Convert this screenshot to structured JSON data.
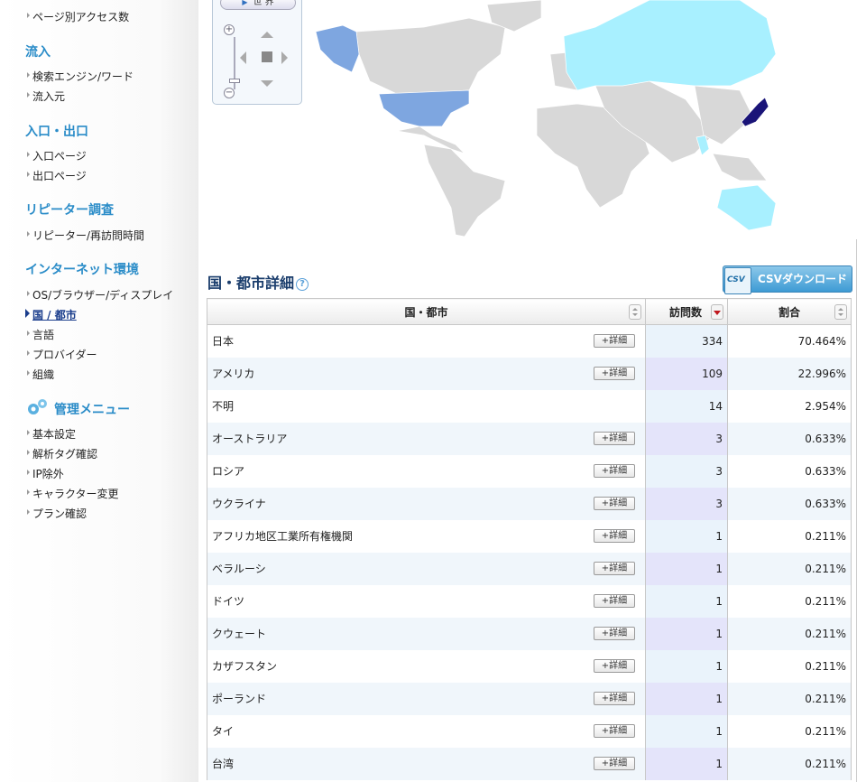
{
  "sidebar": {
    "top_item": "ページ別アクセス数",
    "sections": [
      {
        "title": "流入",
        "items": [
          "検索エンジン/ワード",
          "流入元"
        ]
      },
      {
        "title": "入口・出口",
        "items": [
          "入口ページ",
          "出口ページ"
        ]
      },
      {
        "title": "リピーター調査",
        "items": [
          "リピーター/再訪問時間"
        ]
      },
      {
        "title": "インターネット環境",
        "items": [
          "OS/ブラウザー/ディスプレイ",
          "国 / 都市",
          "言語",
          "プロバイダー",
          "組織"
        ]
      },
      {
        "title": "管理メニュー",
        "items": [
          "基本設定",
          "解析タグ確認",
          "IP除外",
          "キャラクター変更",
          "プラン確認"
        ]
      }
    ],
    "active_item": "国 / 都市"
  },
  "map": {
    "world_button": "世 界",
    "colors": {
      "high": "#1a1478",
      "mid": "#7ea6e0",
      "low": "#a8f0ff",
      "none": "#d8d8d8"
    }
  },
  "main": {
    "title": "国・都市詳細",
    "help": "?",
    "csv_button": "CSVダウンロード",
    "csv_icon": "CSV",
    "table": {
      "headers": [
        "国・都市",
        "訪問数",
        "割合"
      ],
      "detail_label": "+詳細",
      "rows": [
        {
          "name": "日本",
          "visits": "334",
          "share": "70.464%",
          "detail": true
        },
        {
          "name": "アメリカ",
          "visits": "109",
          "share": "22.996%",
          "detail": true
        },
        {
          "name": "不明",
          "visits": "14",
          "share": "2.954%",
          "detail": false
        },
        {
          "name": "オーストラリア",
          "visits": "3",
          "share": "0.633%",
          "detail": true
        },
        {
          "name": "ロシア",
          "visits": "3",
          "share": "0.633%",
          "detail": true
        },
        {
          "name": "ウクライナ",
          "visits": "3",
          "share": "0.633%",
          "detail": true
        },
        {
          "name": "アフリカ地区工業所有権機関",
          "visits": "1",
          "share": "0.211%",
          "detail": true
        },
        {
          "name": "ベラルーシ",
          "visits": "1",
          "share": "0.211%",
          "detail": true
        },
        {
          "name": "ドイツ",
          "visits": "1",
          "share": "0.211%",
          "detail": true
        },
        {
          "name": "クウェート",
          "visits": "1",
          "share": "0.211%",
          "detail": true
        },
        {
          "name": "カザフスタン",
          "visits": "1",
          "share": "0.211%",
          "detail": true
        },
        {
          "name": "ポーランド",
          "visits": "1",
          "share": "0.211%",
          "detail": true
        },
        {
          "name": "タイ",
          "visits": "1",
          "share": "0.211%",
          "detail": true
        },
        {
          "name": "台湾",
          "visits": "1",
          "share": "0.211%",
          "detail": true
        }
      ]
    }
  }
}
